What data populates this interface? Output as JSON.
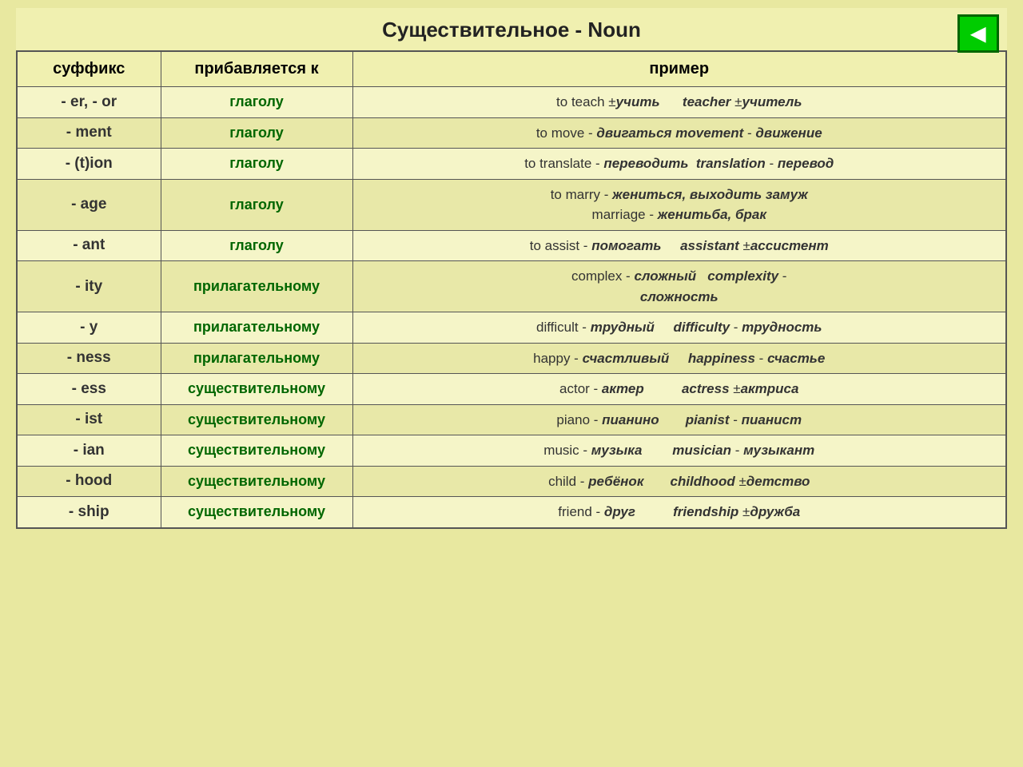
{
  "title": "Существительное - Noun",
  "nav_button": "◀",
  "header": {
    "suffix": "суффикс",
    "added_to": "прибавляется к",
    "example": "пример"
  },
  "rows": [
    {
      "suffix": "- er, - or",
      "added_to": "глаголу",
      "example_html": "to teach ±<i><b>учить</b></i> &nbsp;&nbsp;&nbsp;&nbsp; <i><b>teacher</b></i> ±<i><b>учитель</b></i>"
    },
    {
      "suffix": "- ment",
      "added_to": "глаголу",
      "example_html": "to move - <i><b>двигаться</b></i> <i><b>movement</b></i> - <i><b>движение</b></i>"
    },
    {
      "suffix": "- (t)ion",
      "added_to": "глаголу",
      "example_html": "to translate - <i><b>переводить</b></i> &nbsp;<i><b>translation</b></i> - <i><b>перевод</b></i>"
    },
    {
      "suffix": "- age",
      "added_to": "глаголу",
      "example_html": "to marry - <i><b>жениться, выходить замуж</b></i><br>marriage - <i><b>женитьба, брак</b></i>"
    },
    {
      "suffix": "- ant",
      "added_to": "глаголу",
      "example_html": "to assist - <i><b>помогать</b></i> &nbsp;&nbsp;&nbsp; <i><b>assistant</b></i> ±<i><b>ассистент</b></i>"
    },
    {
      "suffix": "- ity",
      "added_to": "прилагательному",
      "example_html": "complex - <i><b>сложный</b></i> &nbsp; <i><b>complexity</b></i> -<br><i><b>сложность</b></i>"
    },
    {
      "suffix": "- y",
      "added_to": "прилагательному",
      "example_html": "difficult - <i><b>трудный</b></i> &nbsp;&nbsp;&nbsp; <i><b>difficulty</b></i> - <i><b>трудность</b></i>"
    },
    {
      "suffix": "- ness",
      "added_to": "прилагательному",
      "example_html": "happy - <i><b>счастливый</b></i> &nbsp;&nbsp;&nbsp; <i><b>happiness</b></i> - <i><b>счастье</b></i>"
    },
    {
      "suffix": "- ess",
      "added_to": "существительному",
      "example_html": "actor - <i><b>актер</b></i> &nbsp;&nbsp;&nbsp;&nbsp;&nbsp;&nbsp;&nbsp;&nbsp; <i><b>actress</b></i> ±<i><b>актриса</b></i>"
    },
    {
      "suffix": "- ist",
      "added_to": "существительному",
      "example_html": "piano - <i><b>пианино</b></i> &nbsp;&nbsp;&nbsp;&nbsp;&nbsp; <i><b>pianist</b></i> - <i><b>пианист</b></i>"
    },
    {
      "suffix": "- ian",
      "added_to": "существительному",
      "example_html": "music - <i><b>музыка</b></i> &nbsp;&nbsp;&nbsp;&nbsp;&nbsp;&nbsp; <i><b>musician</b></i> - <i><b>музыкант</b></i>"
    },
    {
      "suffix": "- hood",
      "added_to": "существительному",
      "example_html": "child - <i><b>ребёнок</b></i> &nbsp;&nbsp;&nbsp;&nbsp;&nbsp; <i><b>childhood</b></i> ±<i><b>детство</b></i>"
    },
    {
      "suffix": "- ship",
      "added_to": "существительному",
      "example_html": "friend - <i><b>друг</b></i> &nbsp;&nbsp;&nbsp;&nbsp;&nbsp;&nbsp;&nbsp;&nbsp; <i><b>friendship</b></i> ±<i><b>дружба</b></i>"
    }
  ]
}
